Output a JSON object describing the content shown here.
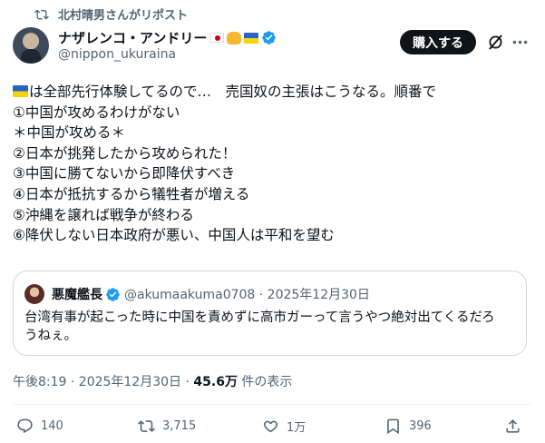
{
  "repost": {
    "label": "北村晴男さんがリポスト"
  },
  "author": {
    "name": "ナザレンコ・アンドリー",
    "handle": "@nippon_ukuraina"
  },
  "header": {
    "subscribe_label": "購入する"
  },
  "post": {
    "lines": [
      "は全部先行体験してるので…　売国奴の主張はこうなる。順番で",
      "①中国が攻めるわけがない",
      "＊中国が攻める＊",
      "②日本が挑発したから攻められた！",
      "③中国に勝てないから即降伏すべき",
      "④日本が抵抗するから犠牲者が増える",
      "⑤沖縄を譲れば戦争が終わる",
      "⑥降伏しない日本政府が悪い、中国人は平和を望む"
    ]
  },
  "quote": {
    "name": "悪魔艦長",
    "meta": "@akumaakuma0708 · 2025年12月30日",
    "text_lines": [
      "台湾有事が起こった時に中国を責めずに高市ガーって言うやつ絶対出てくるだろ",
      "うねぇ。"
    ]
  },
  "stamp": {
    "time": "午後8:19 · 2025年12月30日 · ",
    "views": "45.6万",
    "views_suffix": " 件の表示"
  },
  "actions": {
    "replies": "140",
    "reposts": "3,715",
    "likes": "1万",
    "bookmarks": "396"
  },
  "colors": {
    "verified": "#1d9bf0",
    "secondary_text": "#536471",
    "border": "#cfd9de"
  }
}
